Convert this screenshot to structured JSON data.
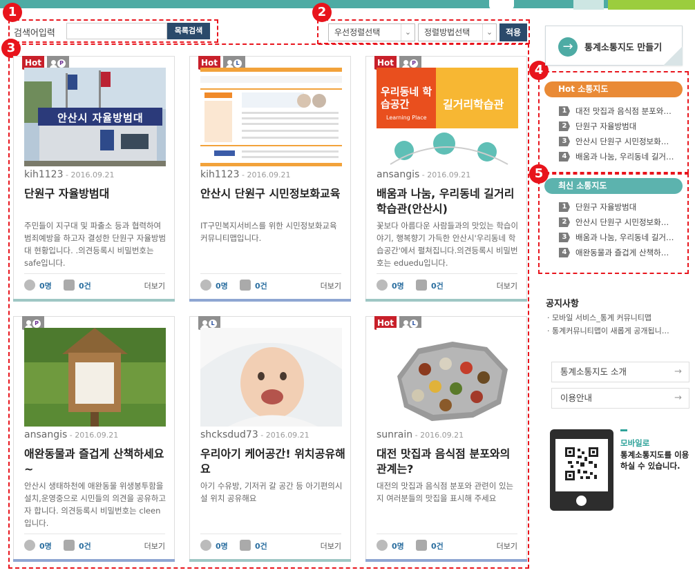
{
  "search": {
    "label": "검색어입력",
    "value": "",
    "placeholder": "",
    "button_label": "목록검색"
  },
  "filters": {
    "priority_select": "우선정렬선택",
    "order_select": "정렬방법선택",
    "apply_label": "적용"
  },
  "annotations": [
    "1",
    "2",
    "3",
    "4",
    "5"
  ],
  "icons": {
    "select_chevron": "chevron-down-icon",
    "make_map_arrow": "arrow-right-icon",
    "participants": "person-icon",
    "likes": "thumbs-up-icon",
    "link_arrow": "arrow-right-icon"
  },
  "colors": {
    "accent": "#4eaba4",
    "hot": "#c8202a",
    "annotation": "#e8141c",
    "button": "#2b4a6b",
    "hot_map_header": "#e98a36",
    "recent_map_header": "#5cb3ae"
  },
  "cards": [
    {
      "hot": true,
      "hot_label": "Hot",
      "type": "P",
      "author": "kih1123",
      "date": " - 2016.09.21",
      "title": "단원구 자율방범대",
      "desc": "주민들이 지구대 및 파출소 등과 협력하여 범죄예방을 하고자 결성한 단원구 자율방범대 현황입니다. .의견등록시 비밀번호는 safe입니다.",
      "participants": "0명",
      "likes": "0건",
      "more": "더보기"
    },
    {
      "hot": true,
      "hot_label": "Hot",
      "type": "L",
      "author": "kih1123",
      "date": " - 2016.09.21",
      "title": "안산시 단원구 시민정보화교육",
      "desc": "IT구민복지서비스를 위한 시민정보화교육 커뮤니티맵입니다.",
      "participants": "0명",
      "likes": "0건",
      "more": "더보기"
    },
    {
      "hot": true,
      "hot_label": "Hot",
      "type": "P",
      "author": "ansangis",
      "date": " - 2016.09.21",
      "title": "배움과 나눔, 우리동네 길거리학습관(안산시)",
      "desc": "꽃보다 아름다운 사람들과의 맛있는 학습이야기, 행복향기 가득한 안산시'우리동네 학습공간'에서 펼쳐집니다.의견등록시 비밀번호는 eduedu입니다.",
      "participants": "0명",
      "likes": "0건",
      "more": "더보기",
      "thumb_text": "우리동네 학습공간",
      "thumb_text2": "길거리학습관",
      "thumb_text3": "Learning Place"
    },
    {
      "hot": false,
      "hot_label": "",
      "type": "P",
      "author": "ansangis",
      "date": " - 2016.09.21",
      "title": "애완동물과 즐겁게 산책하세요~",
      "desc": "안산시 생태하천에 애완동물 위생봉투함을 설치,운영중으로 시민들의 의견을 공유하고자 합니다. 의견등록시 비밀번호는 cleen입니다.",
      "participants": "0명",
      "likes": "0건",
      "more": "더보기"
    },
    {
      "hot": false,
      "hot_label": "",
      "type": "L",
      "author": "shcksdud73",
      "date": " - 2016.09.21",
      "title": "우리아기 케어공간! 위치공유해요",
      "desc": "아기 수유방, 기저귀 갈 공간 등 아기편의시설 위치 공유해요",
      "participants": "0명",
      "likes": "0건",
      "more": "더보기"
    },
    {
      "hot": true,
      "hot_label": "Hot",
      "type": "L",
      "author": "sunrain",
      "date": " - 2016.09.21",
      "title": "대전 맛집과 음식점 분포와의 관계는?",
      "desc": "대전의 맛집과 음식점 분포와 관련이 있는지 여러분들의 맛집을 표시해 주세요",
      "participants": "0명",
      "likes": "0건",
      "more": "더보기"
    }
  ],
  "thumb_sign": "안산시 자율방범대",
  "sidebar": {
    "make_map_label": "통계소통지도 만들기",
    "hot_header": "Hot 소통지도",
    "hot_items": [
      {
        "num": "1",
        "label": "대전 맛집과 음식점 분포와…"
      },
      {
        "num": "2",
        "label": "단원구 자율방범대"
      },
      {
        "num": "3",
        "label": "안산시 단원구 시민정보화…"
      },
      {
        "num": "4",
        "label": "배움과 나눔, 우리동네 길거…"
      }
    ],
    "recent_header": "최신 소통지도",
    "recent_items": [
      {
        "num": "1",
        "label": "단원구 자율방범대"
      },
      {
        "num": "2",
        "label": "안산시 단원구 시민정보화…"
      },
      {
        "num": "3",
        "label": "배움과 나눔, 우리동네 길거…"
      },
      {
        "num": "4",
        "label": "애완동물과 즐겁게 산책하…"
      }
    ],
    "notice_title": "공지사항",
    "notices": [
      "· 모바일 서비스_통계 커뮤니티맵",
      "· 통계커뮤니티맵이 새롭게 공개됩니…"
    ],
    "links": [
      {
        "label": "통계소통지도 소개"
      },
      {
        "label": "이용안내"
      }
    ],
    "mobile_head": "모바일로",
    "mobile_text": "통계소통지도를 이용하실 수 있습니다."
  }
}
